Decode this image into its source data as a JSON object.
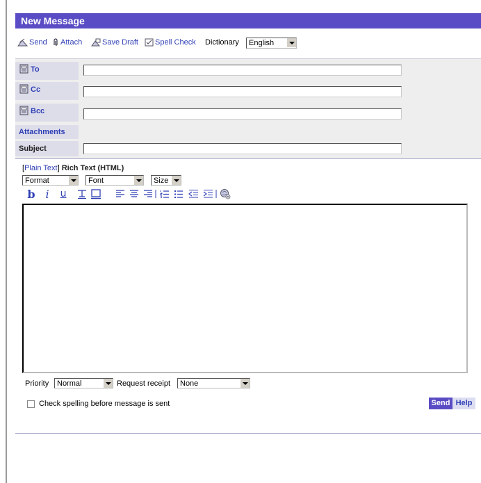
{
  "window_title": "New Message",
  "toolbar": {
    "send": "Send",
    "attach": "Attach",
    "save_draft": "Save Draft",
    "spell_check": "Spell Check",
    "dictionary_label": "Dictionary",
    "dictionary_value": "English"
  },
  "headers": {
    "to": "To",
    "cc": "Cc",
    "bcc": "Bcc",
    "attachments": "Attachments",
    "subject": "Subject",
    "to_value": "",
    "cc_value": "",
    "bcc_value": "",
    "subject_value": ""
  },
  "editor_mode": {
    "open_bracket": "[",
    "plain_text": "Plain Text",
    "close_bracket": "]",
    "rich_text": "Rich Text (HTML)"
  },
  "format_selects": {
    "format": "Format",
    "font": "Font",
    "size": "Size"
  },
  "format_buttons": {
    "bold": "b",
    "italic": "i",
    "underline": "u"
  },
  "body_text": "",
  "options": {
    "priority_label": "Priority",
    "priority_value": "Normal",
    "receipt_label": "Request receipt",
    "receipt_value": "None",
    "spell_before_send": "Check spelling before message is sent",
    "spell_before_send_checked": false
  },
  "actions": {
    "send": "Send",
    "help": "Help"
  },
  "colors": {
    "title_bar": "#5a4cc4",
    "link": "#2f3fb5",
    "header_panel": "#eeeeee",
    "label_cell": "#ddddea"
  }
}
